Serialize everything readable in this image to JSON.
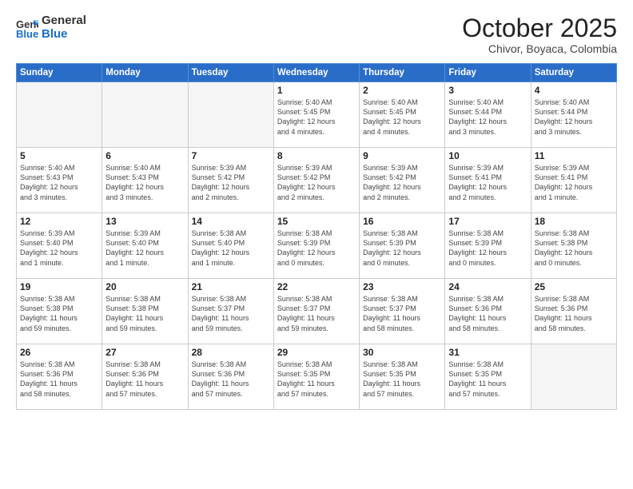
{
  "header": {
    "logo_general": "General",
    "logo_blue": "Blue",
    "month_year": "October 2025",
    "location": "Chivor, Boyaca, Colombia"
  },
  "weekdays": [
    "Sunday",
    "Monday",
    "Tuesday",
    "Wednesday",
    "Thursday",
    "Friday",
    "Saturday"
  ],
  "weeks": [
    [
      {
        "day": "",
        "info": ""
      },
      {
        "day": "",
        "info": ""
      },
      {
        "day": "",
        "info": ""
      },
      {
        "day": "1",
        "info": "Sunrise: 5:40 AM\nSunset: 5:45 PM\nDaylight: 12 hours\nand 4 minutes."
      },
      {
        "day": "2",
        "info": "Sunrise: 5:40 AM\nSunset: 5:45 PM\nDaylight: 12 hours\nand 4 minutes."
      },
      {
        "day": "3",
        "info": "Sunrise: 5:40 AM\nSunset: 5:44 PM\nDaylight: 12 hours\nand 3 minutes."
      },
      {
        "day": "4",
        "info": "Sunrise: 5:40 AM\nSunset: 5:44 PM\nDaylight: 12 hours\nand 3 minutes."
      }
    ],
    [
      {
        "day": "5",
        "info": "Sunrise: 5:40 AM\nSunset: 5:43 PM\nDaylight: 12 hours\nand 3 minutes."
      },
      {
        "day": "6",
        "info": "Sunrise: 5:40 AM\nSunset: 5:43 PM\nDaylight: 12 hours\nand 3 minutes."
      },
      {
        "day": "7",
        "info": "Sunrise: 5:39 AM\nSunset: 5:42 PM\nDaylight: 12 hours\nand 2 minutes."
      },
      {
        "day": "8",
        "info": "Sunrise: 5:39 AM\nSunset: 5:42 PM\nDaylight: 12 hours\nand 2 minutes."
      },
      {
        "day": "9",
        "info": "Sunrise: 5:39 AM\nSunset: 5:42 PM\nDaylight: 12 hours\nand 2 minutes."
      },
      {
        "day": "10",
        "info": "Sunrise: 5:39 AM\nSunset: 5:41 PM\nDaylight: 12 hours\nand 2 minutes."
      },
      {
        "day": "11",
        "info": "Sunrise: 5:39 AM\nSunset: 5:41 PM\nDaylight: 12 hours\nand 1 minute."
      }
    ],
    [
      {
        "day": "12",
        "info": "Sunrise: 5:39 AM\nSunset: 5:40 PM\nDaylight: 12 hours\nand 1 minute."
      },
      {
        "day": "13",
        "info": "Sunrise: 5:39 AM\nSunset: 5:40 PM\nDaylight: 12 hours\nand 1 minute."
      },
      {
        "day": "14",
        "info": "Sunrise: 5:38 AM\nSunset: 5:40 PM\nDaylight: 12 hours\nand 1 minute."
      },
      {
        "day": "15",
        "info": "Sunrise: 5:38 AM\nSunset: 5:39 PM\nDaylight: 12 hours\nand 0 minutes."
      },
      {
        "day": "16",
        "info": "Sunrise: 5:38 AM\nSunset: 5:39 PM\nDaylight: 12 hours\nand 0 minutes."
      },
      {
        "day": "17",
        "info": "Sunrise: 5:38 AM\nSunset: 5:39 PM\nDaylight: 12 hours\nand 0 minutes."
      },
      {
        "day": "18",
        "info": "Sunrise: 5:38 AM\nSunset: 5:38 PM\nDaylight: 12 hours\nand 0 minutes."
      }
    ],
    [
      {
        "day": "19",
        "info": "Sunrise: 5:38 AM\nSunset: 5:38 PM\nDaylight: 11 hours\nand 59 minutes."
      },
      {
        "day": "20",
        "info": "Sunrise: 5:38 AM\nSunset: 5:38 PM\nDaylight: 11 hours\nand 59 minutes."
      },
      {
        "day": "21",
        "info": "Sunrise: 5:38 AM\nSunset: 5:37 PM\nDaylight: 11 hours\nand 59 minutes."
      },
      {
        "day": "22",
        "info": "Sunrise: 5:38 AM\nSunset: 5:37 PM\nDaylight: 11 hours\nand 59 minutes."
      },
      {
        "day": "23",
        "info": "Sunrise: 5:38 AM\nSunset: 5:37 PM\nDaylight: 11 hours\nand 58 minutes."
      },
      {
        "day": "24",
        "info": "Sunrise: 5:38 AM\nSunset: 5:36 PM\nDaylight: 11 hours\nand 58 minutes."
      },
      {
        "day": "25",
        "info": "Sunrise: 5:38 AM\nSunset: 5:36 PM\nDaylight: 11 hours\nand 58 minutes."
      }
    ],
    [
      {
        "day": "26",
        "info": "Sunrise: 5:38 AM\nSunset: 5:36 PM\nDaylight: 11 hours\nand 58 minutes."
      },
      {
        "day": "27",
        "info": "Sunrise: 5:38 AM\nSunset: 5:36 PM\nDaylight: 11 hours\nand 57 minutes."
      },
      {
        "day": "28",
        "info": "Sunrise: 5:38 AM\nSunset: 5:36 PM\nDaylight: 11 hours\nand 57 minutes."
      },
      {
        "day": "29",
        "info": "Sunrise: 5:38 AM\nSunset: 5:35 PM\nDaylight: 11 hours\nand 57 minutes."
      },
      {
        "day": "30",
        "info": "Sunrise: 5:38 AM\nSunset: 5:35 PM\nDaylight: 11 hours\nand 57 minutes."
      },
      {
        "day": "31",
        "info": "Sunrise: 5:38 AM\nSunset: 5:35 PM\nDaylight: 11 hours\nand 57 minutes."
      },
      {
        "day": "",
        "info": ""
      }
    ]
  ]
}
